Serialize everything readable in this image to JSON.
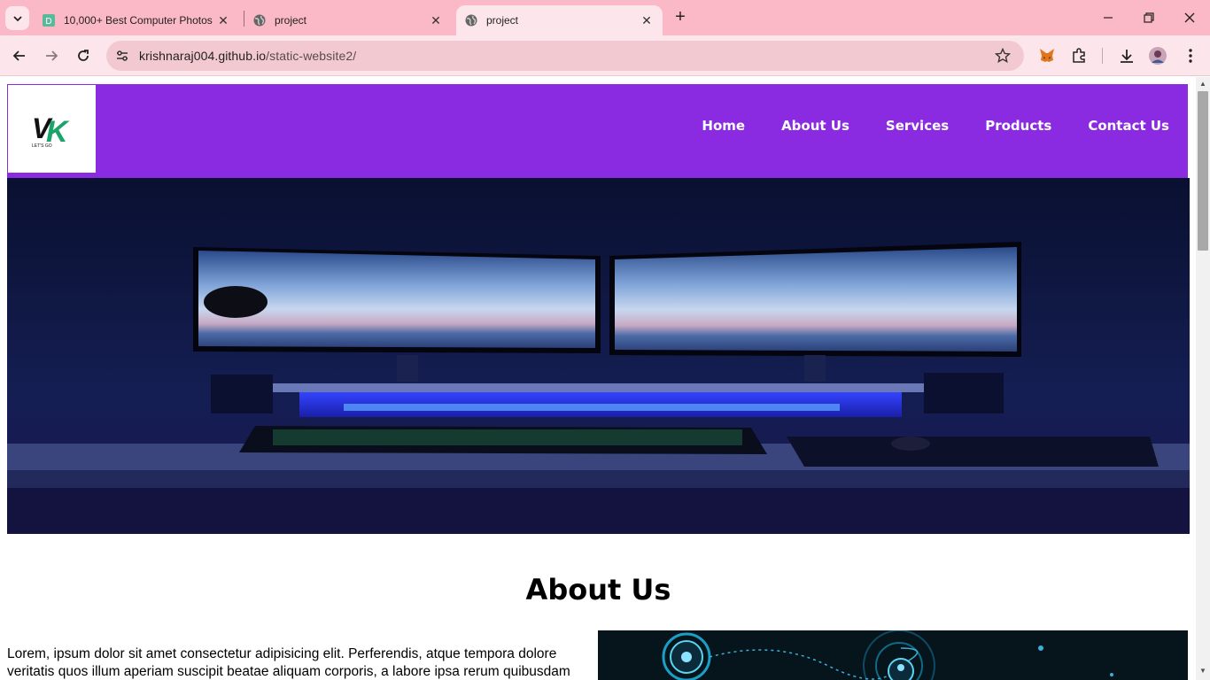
{
  "browser": {
    "tabs": [
      {
        "title": "10,000+ Best Computer Photos",
        "favicon": "d-letter-icon",
        "active": false
      },
      {
        "title": "project",
        "favicon": "globe-icon",
        "active": false
      },
      {
        "title": "project",
        "favicon": "globe-icon",
        "active": true
      }
    ],
    "url_host": "krishnaraj004.github.io",
    "url_path": "/static-website2/",
    "colors": {
      "tabstrip": "#fbb8c6",
      "toolbar": "#fde6eb",
      "omnibox": "#f3c9d1"
    }
  },
  "site": {
    "logo_text": "VK",
    "logo_sub": "LET'S GO",
    "nav": [
      "Home",
      "About Us",
      "Services",
      "Products",
      "Contact Us"
    ],
    "header_color": "#8a2be2",
    "about_title": "About Us",
    "about_text": "Lorem, ipsum dolor sit amet consectetur adipisicing elit. Perferendis, atque tempora dolore veritatis quos illum aperiam suscipit beatae aliquam corporis, a labore ipsa rerum quibusdam"
  }
}
